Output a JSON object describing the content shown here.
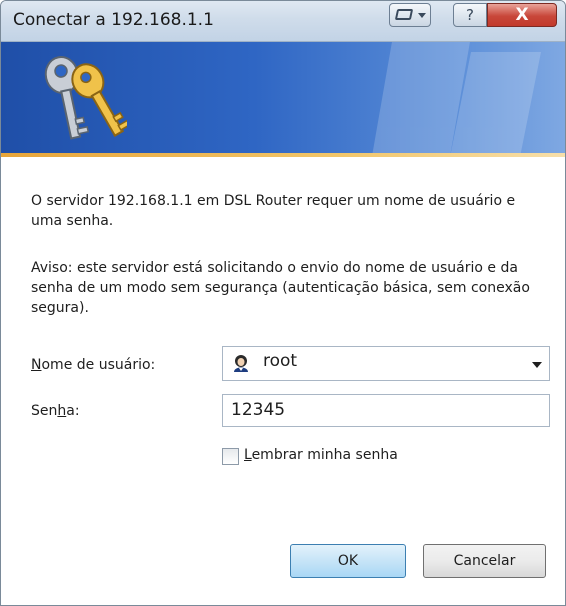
{
  "window": {
    "title": "Conectar a 192.168.1.1",
    "close_glyph": "X",
    "help_glyph": "?"
  },
  "banner": {
    "icon": "keys-icon"
  },
  "message": {
    "paragraph1": "O servidor 192.168.1.1 em DSL Router requer um nome de usuário e uma senha.",
    "paragraph2": "Aviso: este servidor está solicitando o envio do nome de usuário e da senha de um modo sem segurança (autenticação básica, sem conexão segura)."
  },
  "form": {
    "username_label_accesskey": "N",
    "username_label_rest": "ome de usuário:",
    "username_value": "root",
    "password_label_before": "Sen",
    "password_label_accesskey": "h",
    "password_label_after": "a:",
    "password_value": "12345",
    "remember_accesskey": "L",
    "remember_rest": "embrar minha senha",
    "remember_checked": false
  },
  "buttons": {
    "ok": "OK",
    "cancel": "Cancelar"
  },
  "colors": {
    "banner_blue": "#2f66c4",
    "accent_orange": "#e7a53a",
    "close_red": "#c8473a",
    "ok_blue": "#c6e4f7"
  }
}
